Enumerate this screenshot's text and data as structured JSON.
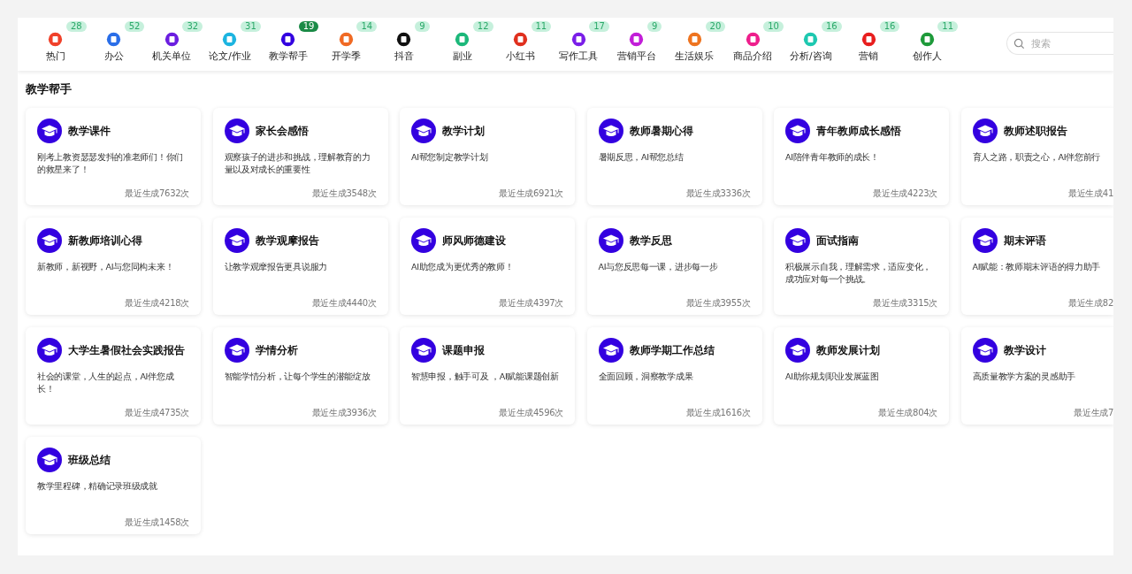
{
  "nav": [
    {
      "label": "热门",
      "count": "28",
      "selected": false,
      "color": "#f0412a"
    },
    {
      "label": "办公",
      "count": "52",
      "selected": false,
      "color": "#2a6ee8"
    },
    {
      "label": "机关单位",
      "count": "32",
      "selected": false,
      "color": "#6b1ee0"
    },
    {
      "label": "论文/作业",
      "count": "31",
      "selected": false,
      "color": "#1cb4e0"
    },
    {
      "label": "教学帮手",
      "count": "19",
      "selected": true,
      "color": "#3300e0"
    },
    {
      "label": "开学季",
      "count": "14",
      "selected": false,
      "color": "#f06a24"
    },
    {
      "label": "抖音",
      "count": "9",
      "selected": false,
      "color": "#111111"
    },
    {
      "label": "副业",
      "count": "12",
      "selected": false,
      "color": "#1cb87a"
    },
    {
      "label": "小红书",
      "count": "11",
      "selected": false,
      "color": "#e0301e"
    },
    {
      "label": "写作工具",
      "count": "17",
      "selected": false,
      "color": "#7a1ee8"
    },
    {
      "label": "营销平台",
      "count": "9",
      "selected": false,
      "color": "#c21ed8"
    },
    {
      "label": "生活娱乐",
      "count": "20",
      "selected": false,
      "color": "#ee7420"
    },
    {
      "label": "商品介绍",
      "count": "10",
      "selected": false,
      "color": "#ee1e8c"
    },
    {
      "label": "分析/咨询",
      "count": "16",
      "selected": false,
      "color": "#1ec8b0"
    },
    {
      "label": "营销",
      "count": "16",
      "selected": false,
      "color": "#e81e1e"
    },
    {
      "label": "创作人",
      "count": "11",
      "selected": false,
      "color": "#1e9a3a"
    }
  ],
  "search": {
    "placeholder": "搜索"
  },
  "section_title": "教学帮手",
  "cards": [
    {
      "title": "教学课件",
      "desc": "刚考上教资瑟瑟发抖的准老师们！你们的救星来了！",
      "stat": "最近生成7632次"
    },
    {
      "title": "家长会感悟",
      "desc": "观察孩子的进步和挑战，理解教育的力量以及对成长的重要性",
      "stat": "最近生成3548次"
    },
    {
      "title": "教学计划",
      "desc": "AI帮您制定教学计划",
      "stat": "最近生成6921次"
    },
    {
      "title": "教师暑期心得",
      "desc": "暑期反思，AI帮您总结",
      "stat": "最近生成3336次"
    },
    {
      "title": "青年教师成长感悟",
      "desc": "AI陪伴青年教师的成长！",
      "stat": "最近生成4223次"
    },
    {
      "title": "教师述职报告",
      "desc": "育人之路，职责之心，AI伴您前行",
      "stat": "最近生成41"
    },
    {
      "title": "新教师培训心得",
      "desc": "新教师，新视野，AI与您同构未来！",
      "stat": "最近生成4218次"
    },
    {
      "title": "教学观摩报告",
      "desc": "让教学观摩报告更具说服力",
      "stat": "最近生成4440次"
    },
    {
      "title": "师风师德建设",
      "desc": "AI助您成为更优秀的教师！",
      "stat": "最近生成4397次"
    },
    {
      "title": "教学反思",
      "desc": "AI与您反思每一课，进步每一步",
      "stat": "最近生成3955次"
    },
    {
      "title": "面试指南",
      "desc": "积极展示自我，理解需求，适应变化，成功应对每一个挑战。",
      "stat": "最近生成3315次"
    },
    {
      "title": "期末评语",
      "desc": "AI赋能：教师期末评语的得力助手",
      "stat": "最近生成82"
    },
    {
      "title": "大学生暑假社会实践报告",
      "desc": "社会的课堂，人生的起点，AI伴您成长！",
      "stat": "最近生成4735次"
    },
    {
      "title": "学情分析",
      "desc": "智能学情分析，让每个学生的潜能绽放",
      "stat": "最近生成3936次"
    },
    {
      "title": "课题申报",
      "desc": "智慧申报，触手可及 ，AI赋能课题创新",
      "stat": "最近生成4596次"
    },
    {
      "title": "教师学期工作总结",
      "desc": "全面回顾，洞察教学成果",
      "stat": "最近生成1616次"
    },
    {
      "title": "教师发展计划",
      "desc": "AI助你规划职业发展蓝图",
      "stat": "最近生成804次"
    },
    {
      "title": "教学设计",
      "desc": "高质量教学方案的灵感助手",
      "stat": "最近生成7"
    },
    {
      "title": "班级总结",
      "desc": "教学里程碑，精确记录班级成就",
      "stat": "最近生成1458次"
    }
  ]
}
